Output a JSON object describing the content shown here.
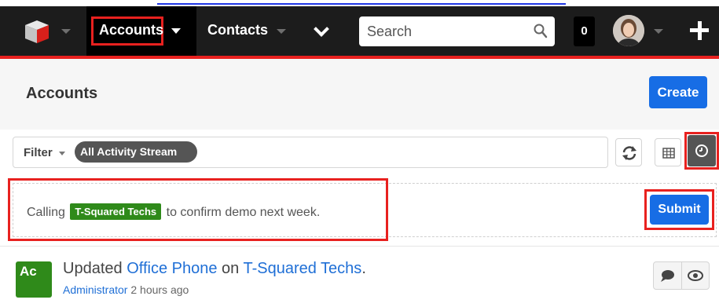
{
  "navbar": {
    "modules": [
      {
        "label": "Accounts",
        "active": true
      },
      {
        "label": "Contacts",
        "active": false
      }
    ],
    "search_placeholder": "Search",
    "notification_count": "0",
    "accent_color": "#e8211f"
  },
  "header": {
    "title": "Accounts",
    "create_label": "Create"
  },
  "filter": {
    "label": "Filter",
    "selected": "All Activity Stream"
  },
  "post": {
    "text_before": "Calling",
    "tag": "T-Squared Techs",
    "text_after": "to confirm demo next week.",
    "submit_label": "Submit"
  },
  "activity": {
    "avatar_initials": "Ac",
    "verb": "Updated",
    "field": "Office Phone",
    "preposition": "on",
    "record": "T-Squared Techs",
    "end": ".",
    "author": "Administrator",
    "time": "2 hours ago"
  }
}
